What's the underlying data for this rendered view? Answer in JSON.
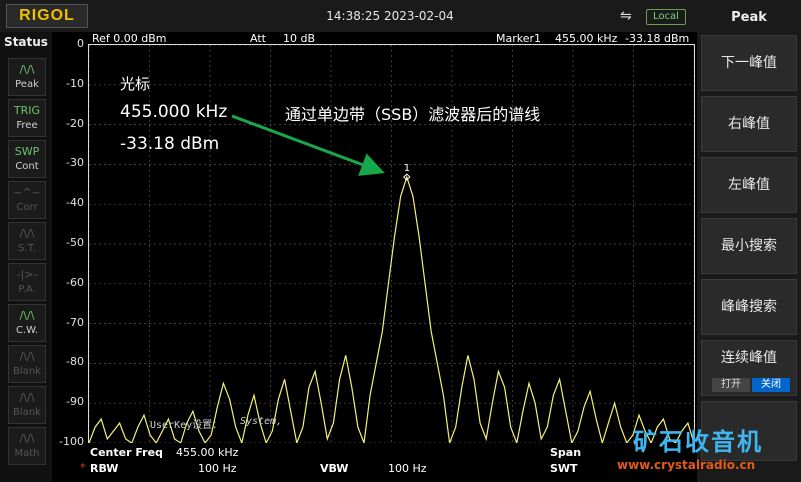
{
  "header": {
    "logo": "RIGOL",
    "datetime": "14:38:25 2023-02-04",
    "remote_label": "Local"
  },
  "status": {
    "title": "Status",
    "items": [
      {
        "sym": "/\\/\\",
        "label": "Peak",
        "state": "on"
      },
      {
        "sym": "TRIG",
        "label": "Free",
        "state": "on"
      },
      {
        "sym": "SWP",
        "label": "Cont",
        "state": "on"
      },
      {
        "sym": "~^~",
        "label": "Corr",
        "state": "off"
      },
      {
        "sym": "/\\/\\",
        "label": "S.T.",
        "state": "off"
      },
      {
        "sym": "-|>-",
        "label": "P.A.",
        "state": "off"
      },
      {
        "sym": "/\\/\\",
        "label": "C.W.",
        "state": "on"
      },
      {
        "sym": "/\\/\\",
        "label": "Blank",
        "state": "off"
      },
      {
        "sym": "/\\/\\",
        "label": "Blank",
        "state": "off"
      },
      {
        "sym": "/\\/\\",
        "label": "Math",
        "state": "off"
      }
    ]
  },
  "topline": {
    "ref": "Ref  0.00 dBm",
    "att_label": "Att",
    "att_value": "10 dB",
    "marker_label": "Marker1",
    "marker_freq": "455.00 kHz",
    "marker_level": "-33.18 dBm"
  },
  "y_axis": [
    "0",
    "-10",
    "-20",
    "-30",
    "-40",
    "-50",
    "-60",
    "-70",
    "-80",
    "-90",
    "-100"
  ],
  "annotation": {
    "marker_title": "光标",
    "marker_freq": "455.000 kHz",
    "marker_level": "-33.18 dBm",
    "caption": "通过单边带（SSB）滤波器后的谱线",
    "marker_num": "1"
  },
  "overlay": {
    "userkey": "UserKey设置：",
    "system": "System,"
  },
  "bottom": {
    "center_label": "Center Freq",
    "center_value": "455.00 kHz",
    "span_label": "Span",
    "rbw_marker": "*",
    "rbw_label": "RBW",
    "rbw_value": "100 Hz",
    "vbw_label": "VBW",
    "vbw_value": "100 Hz",
    "swt_label": "SWT"
  },
  "menu": {
    "title": "Peak",
    "items": [
      "下一峰值",
      "右峰值",
      "左峰值",
      "最小搜索",
      "峰峰搜索"
    ],
    "continuous": {
      "label": "连续峰值",
      "off": "打开",
      "on": "关闭"
    }
  },
  "watermark": {
    "text": "矿石收音机",
    "url": "www.crystalradio.cn"
  },
  "chart_data": {
    "type": "line",
    "ylim": [
      -100,
      0
    ],
    "y_unit": "dBm",
    "center_freq_khz": 455.0,
    "trace": [
      -100,
      -96,
      -94,
      -99,
      -97,
      -95,
      -99,
      -100,
      -96,
      -93,
      -98,
      -100,
      -97,
      -94,
      -99,
      -100,
      -95,
      -92,
      -97,
      -100,
      -98,
      -91,
      -85,
      -89,
      -96,
      -100,
      -93,
      -88,
      -95,
      -100,
      -97,
      -89,
      -84,
      -92,
      -100,
      -96,
      -86,
      -82,
      -90,
      -99,
      -95,
      -84,
      -78,
      -86,
      -96,
      -100,
      -88,
      -80,
      -72,
      -60,
      -48,
      -38,
      -33.2,
      -38,
      -48,
      -60,
      -72,
      -80,
      -88,
      -100,
      -96,
      -86,
      -78,
      -84,
      -95,
      -99,
      -90,
      -82,
      -86,
      -96,
      -100,
      -92,
      -85,
      -90,
      -99,
      -96,
      -88,
      -84,
      -92,
      -100,
      -97,
      -91,
      -87,
      -94,
      -100,
      -95,
      -90,
      -96,
      -100,
      -98,
      -93,
      -97,
      -100,
      -96,
      -94,
      -99,
      -100,
      -97,
      -95,
      -100
    ],
    "marker": {
      "x_index": 52,
      "level": -33.18
    }
  }
}
